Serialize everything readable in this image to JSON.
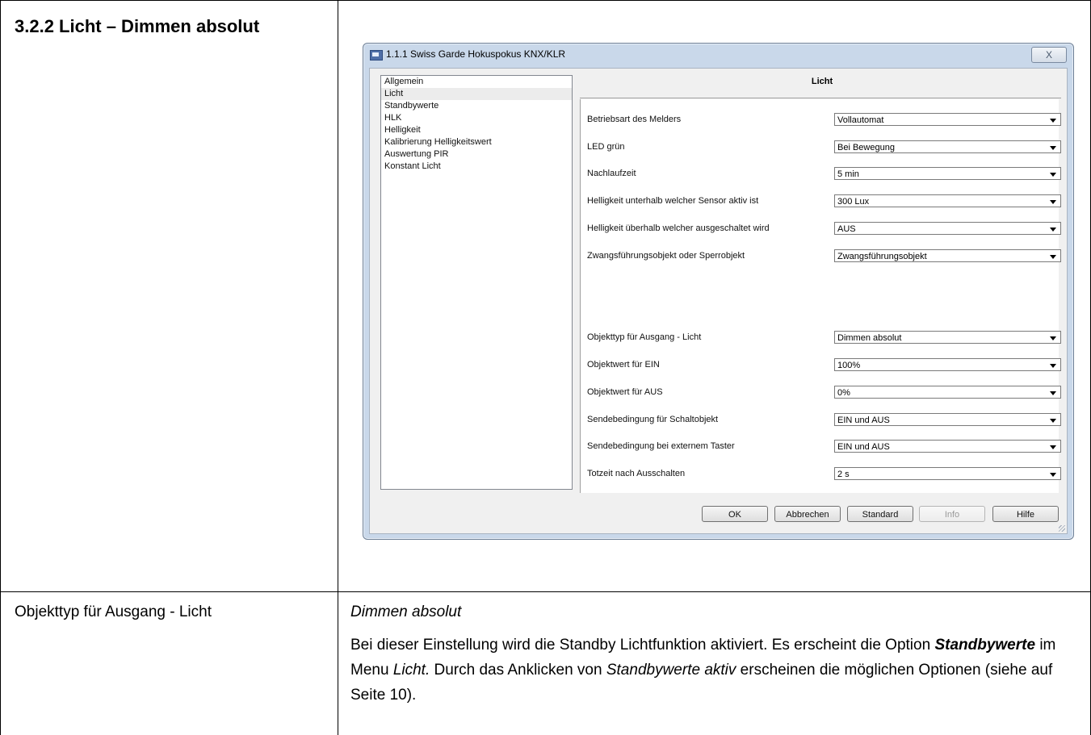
{
  "section": {
    "heading": "3.2.2  Licht – Dimmen absolut"
  },
  "dialog": {
    "title": "1.1.1 Swiss Garde Hokuspokus KNX/KLR",
    "close_label": "X",
    "nav_items": [
      "Allgemein",
      "Licht",
      "Standbywerte",
      "HLK",
      "Helligkeit",
      "Kalibrierung Helligkeitswert",
      "Auswertung PIR",
      "Konstant Licht"
    ],
    "selected_nav": "Licht",
    "panel_title": "Licht",
    "params": [
      {
        "label": "Betriebsart des Melders",
        "value": "Vollautomat"
      },
      {
        "label": "LED grün",
        "value": "Bei Bewegung"
      },
      {
        "label": "Nachlaufzeit",
        "value": "5 min"
      },
      {
        "label": "Helligkeit unterhalb welcher Sensor aktiv ist",
        "value": "300 Lux"
      },
      {
        "label": "Helligkeit überhalb welcher ausgeschaltet wird",
        "value": "AUS"
      },
      {
        "label": "Zwangsführungsobjekt oder Sperrobjekt",
        "value": "Zwangsführungsobjekt"
      },
      {
        "label": "Objekttyp für Ausgang - Licht",
        "value": "Dimmen absolut"
      },
      {
        "label": "Objektwert für EIN",
        "value": "100%"
      },
      {
        "label": "Objektwert für AUS",
        "value": "0%"
      },
      {
        "label": "Sendebedingung für Schaltobjekt",
        "value": "EIN und AUS"
      },
      {
        "label": "Sendebedingung bei externem Taster",
        "value": "EIN und AUS"
      },
      {
        "label": "Totzeit nach Ausschalten",
        "value": "2 s"
      }
    ],
    "buttons": {
      "ok": "OK",
      "cancel": "Abbrechen",
      "standard": "Standard",
      "info": "Info",
      "help": "Hilfe"
    }
  },
  "parameter": {
    "name": "Objekttyp für Ausgang - Licht",
    "value_title": "Dimmen absolut",
    "desc_part1": "Bei dieser Einstellung wird die Standby Lichtfunktion aktiviert. Es erscheint die Option ",
    "desc_bold": "Standbywerte",
    "desc_part2": " im Menu ",
    "desc_menu": "Licht.",
    "desc_part3": " Durch das Anklicken von ",
    "desc_link": "Standbywerte aktiv",
    "desc_part4": " erscheinen die möglichen Optionen (siehe auf Seite 10)."
  }
}
